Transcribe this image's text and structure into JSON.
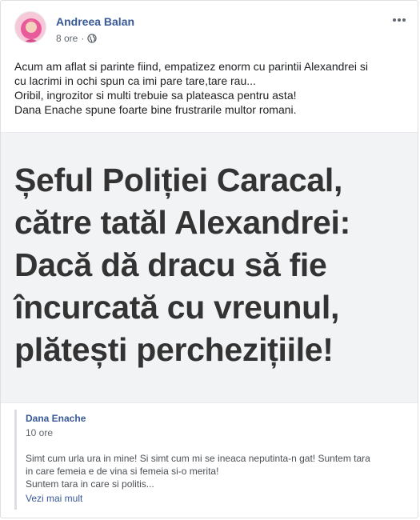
{
  "post": {
    "author": "Andreea Balan",
    "time": "8 ore",
    "separator": "·",
    "privacy_icon": "globe-icon",
    "menu_icon": "more-options-icon",
    "text_lines": [
      "Acum am aflat si parinte fiind, empatizez enorm cu parintii Alexandrei si",
      "cu lacrimi in ochi spun ca imi pare tare,tare rau...",
      "Oribil, ingrozitor si multi trebuie sa plateasca pentru asta!",
      "Dana Enache spune foarte bine frustrarile multor romani."
    ]
  },
  "image": {
    "headline_lines": [
      "Șeful Poliției Caracal,",
      "către tatăl Alexandrei:",
      "Dacă dă dracu să fie",
      "încurcată cu vreunul,",
      "plătești perchezițiile!"
    ]
  },
  "shared_post": {
    "author": "Dana Enache",
    "time": "10 ore",
    "text_lines": [
      "Simt cum urla ura in mine! Si simt cum mi se ineaca neputinta-n gat! Suntem tara",
      "in care femeia e de vina si femeia si-o merita!",
      "Suntem tara in care si politis..."
    ],
    "see_more": "Vezi mai mult"
  },
  "colors": {
    "link_blue": "#385898",
    "meta_gray": "#616770",
    "headline_gray": "#333333",
    "image_bg": "#f2f3f5"
  }
}
